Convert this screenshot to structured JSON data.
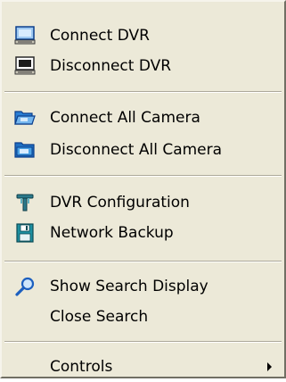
{
  "menu": {
    "items": [
      {
        "label": "Connect DVR",
        "icon": "monitor-icon"
      },
      {
        "label": "Disconnect DVR",
        "icon": "monitor-dark-icon"
      },
      {
        "label": "Connect All Camera",
        "icon": "folder-open-icon"
      },
      {
        "label": "Disconnect All Camera",
        "icon": "folder-closed-icon"
      },
      {
        "label": "DVR Configuration",
        "icon": "tools-icon"
      },
      {
        "label": "Network Backup",
        "icon": "floppy-disk-icon"
      },
      {
        "label": "Show Search Display",
        "icon": "magnifier-icon"
      },
      {
        "label": "Close Search",
        "icon": ""
      },
      {
        "label": "Controls",
        "icon": "submenu-arrow-icon"
      }
    ]
  },
  "colors": {
    "menu_bg": "#ece9d8",
    "separator_dark": "#aca899",
    "icon_blue": "#1c5fbf",
    "icon_teal": "#1d8fa0"
  }
}
